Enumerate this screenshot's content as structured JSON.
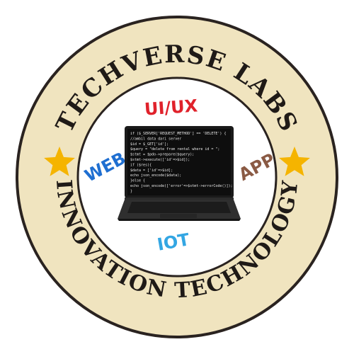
{
  "badge": {
    "top_text": "TECHVERSE LABS",
    "bottom_text": "INNOVATION TECHNOLOGY",
    "tags": {
      "uiux": "UI/UX",
      "web": "WEB",
      "app": "APP",
      "iot": "IOT"
    },
    "colors": {
      "ring": "#f0e4bf",
      "ring_border": "#2a2320",
      "uiux": "#e0222b",
      "web": "#1f6fd1",
      "app": "#8a5a44",
      "iot": "#33a6e3",
      "star": "#f5b400"
    },
    "code_lines": [
      "if ($_SERVER['REQUEST_METHOD'] == 'DELETE') {",
      "   //ambil data dari server",
      "   $id = $_GET['id'];",
      "   $query = \"delete from rental where id = \";",
      "   $stmt = $pdo->prepare($query);",
      "   $stmt->execute(['id'=>$id]);",
      "   if ($res){",
      "     $data = ['id'=>$id];",
      "     echo json_encode($data);",
      "   }else {",
      "     echo json_encode(['error'=>$stmt->errorCode()]);",
      "   }"
    ]
  }
}
